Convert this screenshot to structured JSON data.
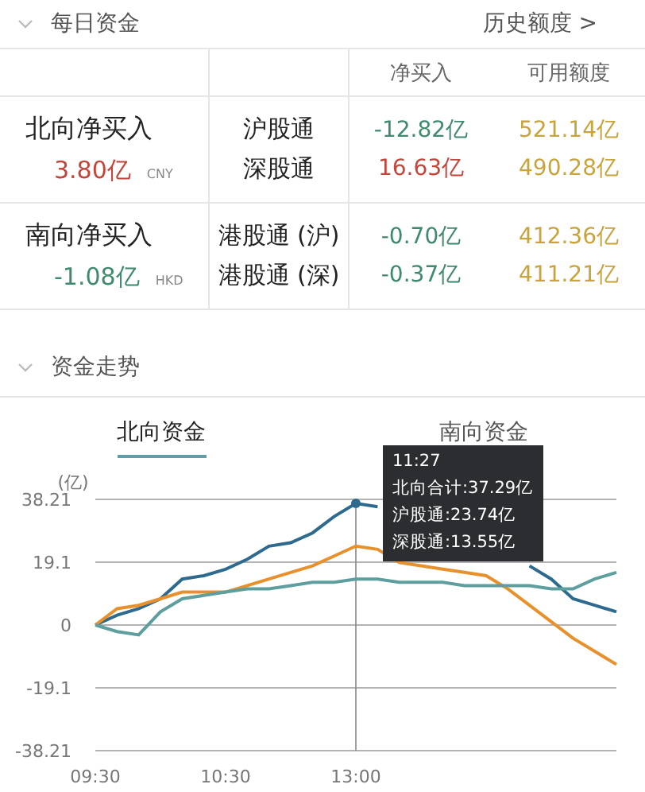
{
  "daily_funds": {
    "title": "每日资金",
    "expanded": true,
    "history_link": "历史额度 >",
    "columns": [
      "净买入",
      "可用额度"
    ],
    "groups": [
      {
        "label": "北向净买入",
        "total": {
          "text": "3.80亿",
          "color": "#c4453a"
        },
        "currency": "CNY",
        "rows": [
          {
            "name": "沪股通",
            "net": {
              "text": "-12.82亿",
              "color": "#3f8a6c"
            },
            "quota": "521.14亿"
          },
          {
            "name": "深股通",
            "net": {
              "text": "16.63亿",
              "color": "#c4453a"
            },
            "quota": "490.28亿"
          }
        ]
      },
      {
        "label": "南向净买入",
        "total": {
          "text": "-1.08亿",
          "color": "#3f8a6c"
        },
        "currency": "HKD",
        "rows": [
          {
            "name": "港股通 (沪)",
            "net": {
              "text": "-0.70亿",
              "color": "#3f8a6c"
            },
            "quota": "412.36亿"
          },
          {
            "name": "港股通 (深)",
            "net": {
              "text": "-0.37亿",
              "color": "#3f8a6c"
            },
            "quota": "411.21亿"
          }
        ]
      }
    ]
  },
  "fund_trend": {
    "title": "资金走势",
    "expanded": true,
    "tabs": [
      {
        "label": "北向资金",
        "selected": true
      },
      {
        "label": "南向资金",
        "selected": false
      }
    ],
    "chart_data": {
      "type": "line",
      "ylabel": "(亿)",
      "categories": [
        "09:30",
        null,
        null,
        null,
        null,
        null,
        "10:30",
        null,
        null,
        null,
        null,
        null,
        "13:00",
        null,
        null,
        null,
        null,
        null,
        null,
        null,
        null,
        null,
        null,
        null,
        null
      ],
      "series": [
        {
          "color": "#2e6a8e",
          "values": [
            0,
            3,
            5,
            8,
            14,
            15,
            17,
            20,
            24,
            25,
            28,
            33,
            37,
            36,
            null,
            null,
            null,
            null,
            null,
            null,
            18,
            14,
            8,
            6,
            4
          ]
        },
        {
          "color": "#e8912c",
          "values": [
            0,
            5,
            6,
            8,
            10,
            10,
            10,
            12,
            14,
            16,
            18,
            21,
            24,
            23,
            19,
            18,
            17,
            16,
            15,
            11,
            6,
            1,
            -4,
            -8,
            -12
          ]
        },
        {
          "color": "#5f9e9f",
          "values": [
            0,
            -2,
            -3,
            4,
            8,
            9,
            10,
            11,
            11,
            12,
            13,
            13,
            14,
            14,
            13,
            13,
            13,
            12,
            12,
            12,
            12,
            11,
            11,
            14,
            16
          ]
        }
      ],
      "ylim": [
        -38.21,
        38.21
      ],
      "grid": true,
      "yticks": [
        38.21,
        19.1,
        0,
        -19.1,
        -38.21
      ]
    },
    "tooltip": {
      "lines": [
        "11:27",
        "北向合计:37.29亿",
        "沪股通:23.74亿",
        "深股通:13.55亿"
      ]
    }
  }
}
